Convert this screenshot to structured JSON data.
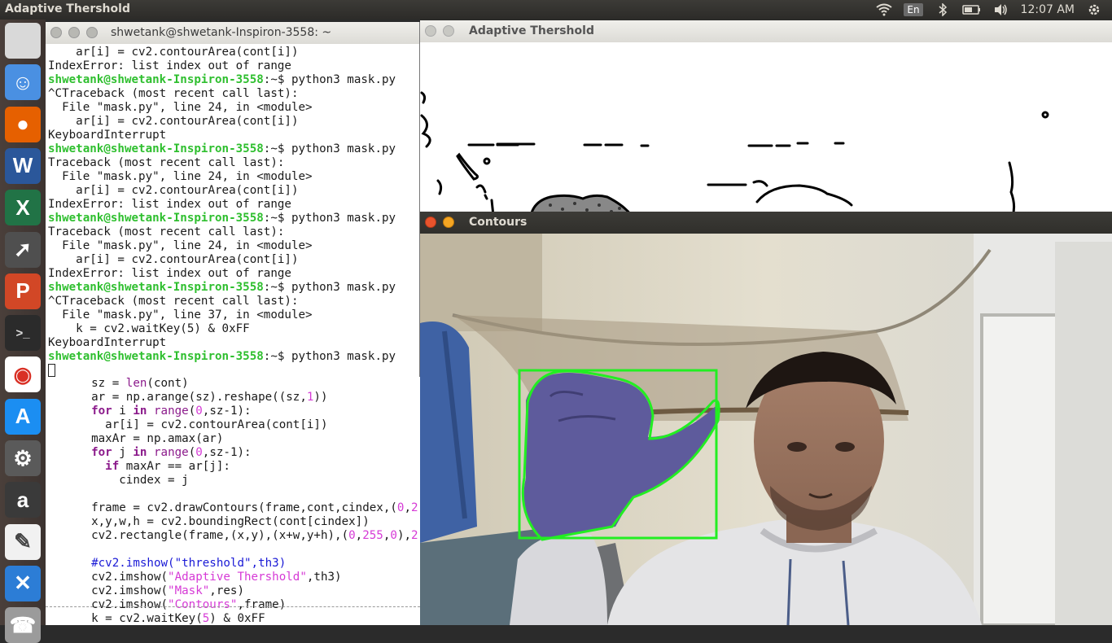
{
  "topbar": {
    "app_title": "Adaptive Thershold",
    "tray": {
      "wifi_icon": "wifi-icon",
      "lang": "En",
      "bluetooth_icon": "bluetooth-icon",
      "battery_icon": "battery-icon",
      "volume_icon": "volume-icon",
      "time": "12:07 AM",
      "gear_icon": "power-gear-icon"
    }
  },
  "launcher": {
    "items": [
      {
        "name": "apple-icon",
        "glyph": ""
      },
      {
        "name": "finder-icon",
        "glyph": "☺"
      },
      {
        "name": "firefox-icon",
        "glyph": "●"
      },
      {
        "name": "word-icon",
        "glyph": "W"
      },
      {
        "name": "excel-icon",
        "glyph": "X"
      },
      {
        "name": "launchpad-icon",
        "glyph": "➚"
      },
      {
        "name": "powerpoint-icon",
        "glyph": "P"
      },
      {
        "name": "terminal-icon",
        "glyph": ">_"
      },
      {
        "name": "chrome-icon",
        "glyph": "◉"
      },
      {
        "name": "app-store-icon",
        "glyph": "A"
      },
      {
        "name": "system-preferences-icon",
        "glyph": "⚙"
      },
      {
        "name": "amazon-icon",
        "glyph": "a"
      },
      {
        "name": "text-editor-icon",
        "glyph": "✎"
      },
      {
        "name": "xcode-icon",
        "glyph": "✕"
      },
      {
        "name": "phone-icon",
        "glyph": "☎"
      }
    ]
  },
  "terminal": {
    "title": "shwetank@shwetank-Inspiron-3558: ~",
    "prompt": "shwetank@shwetank-Inspiron-3558",
    "lines": [
      {
        "t": "    ar[i] = cv2.contourArea(cont[i])"
      },
      {
        "t": "IndexError: list index out of range"
      },
      {
        "p": true,
        "t": ":~$ python3 mask.py"
      },
      {
        "t": "^CTraceback (most recent call last):"
      },
      {
        "t": "  File \"mask.py\", line 24, in <module>"
      },
      {
        "t": "    ar[i] = cv2.contourArea(cont[i])"
      },
      {
        "t": "KeyboardInterrupt"
      },
      {
        "p": true,
        "t": ":~$ python3 mask.py"
      },
      {
        "t": "Traceback (most recent call last):"
      },
      {
        "t": "  File \"mask.py\", line 24, in <module>"
      },
      {
        "t": "    ar[i] = cv2.contourArea(cont[i])"
      },
      {
        "t": "IndexError: list index out of range"
      },
      {
        "p": true,
        "t": ":~$ python3 mask.py"
      },
      {
        "t": "Traceback (most recent call last):"
      },
      {
        "t": "  File \"mask.py\", line 24, in <module>"
      },
      {
        "t": "    ar[i] = cv2.contourArea(cont[i])"
      },
      {
        "t": "IndexError: list index out of range"
      },
      {
        "p": true,
        "t": ":~$ python3 mask.py"
      },
      {
        "t": "^CTraceback (most recent call last):"
      },
      {
        "t": "  File \"mask.py\", line 37, in <module>"
      },
      {
        "t": "    k = cv2.waitKey(5) & 0xFF"
      },
      {
        "t": "KeyboardInterrupt"
      },
      {
        "p": true,
        "t": ":~$ python3 mask.py"
      }
    ]
  },
  "editor": {
    "lines": [
      "  sz = len(cont)",
      "  ar = np.arange(sz).reshape((sz,1))",
      "  for i in range(0,sz-1):",
      "    ar[i] = cv2.contourArea(cont[i])",
      "  maxAr = np.amax(ar)",
      "  for j in range(0,sz-1):",
      "    if maxAr == ar[j]:",
      "      cindex = j",
      "",
      "  frame = cv2.drawContours(frame,cont,cindex,(0,2",
      "  x,y,w,h = cv2.boundingRect(cont[cindex])",
      "  cv2.rectangle(frame,(x,y),(x+w,y+h),(0,255,0),2",
      "",
      "  #cv2.imshow(\"threshold\",th3)",
      "  cv2.imshow(\"Adaptive Thershold\",th3)",
      "  cv2.imshow(\"Mask\",res)",
      "  cv2.imshow(\"Contours\",frame)",
      "  k = cv2.waitKey(5) & 0xFF"
    ]
  },
  "adaptive_window": {
    "title": "Adaptive Thershold"
  },
  "contours_window": {
    "title": "Contours"
  }
}
